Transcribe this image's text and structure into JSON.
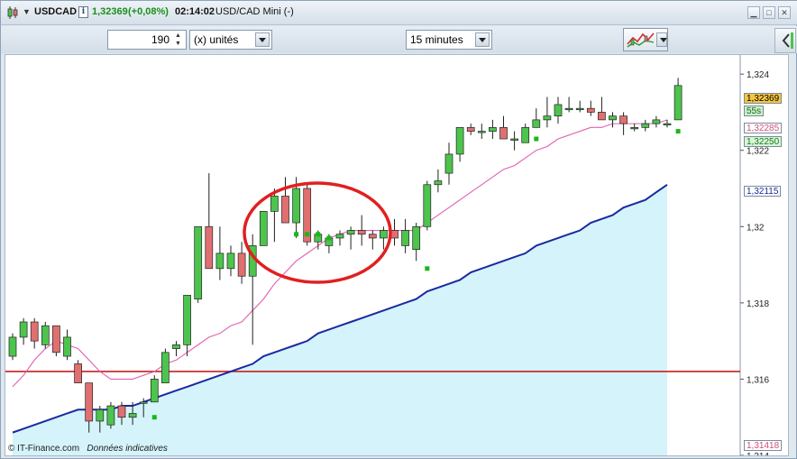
{
  "window": {
    "instrument": "USDCAD",
    "last": "1,32369",
    "change": "(+0,08%)",
    "time": "02:14:02",
    "description": "USD/CAD Mini (-)",
    "up_color": "#1a8f1a"
  },
  "toolbar": {
    "units_value": "190",
    "units_label": "(x) unités",
    "timeframe": "15 minutes"
  },
  "price_tags": [
    {
      "text": "1,32369",
      "bg": "#f5c542",
      "color": "#000000"
    },
    {
      "text": "55s",
      "bg": "#c9f0c9",
      "color": "#226622"
    },
    {
      "text": "1,32285",
      "bg": "#ffffff",
      "color": "#d0507a"
    },
    {
      "text": "1,32250",
      "bg": "#d8f5d8",
      "color": "#1a7a1a"
    },
    {
      "text": "1,32115",
      "bg": "#ffffff",
      "color": "#1a2a9a"
    },
    {
      "text": "1,31418",
      "bg": "#ffffff",
      "color": "#d0507a"
    }
  ],
  "footer": {
    "copyright": "© IT-Finance.com",
    "disclaimer": "Données indicatives"
  },
  "chart_data": {
    "type": "candlestick",
    "ylim": [
      1.314,
      1.3245
    ],
    "yticks": [
      "1,324",
      "1,322",
      "1,32",
      "1,318",
      "1,316",
      "1,314"
    ],
    "ytick_values": [
      1.324,
      1.322,
      1.32,
      1.318,
      1.316,
      1.314
    ],
    "colors": {
      "up": "#4dc44d",
      "down": "#e07070",
      "ma_short": "#e060b0",
      "ma_long": "#1a2aa0",
      "hline": "#c81e1e",
      "sar": "#18b818",
      "annotation": "#e02020",
      "area": "#d4f3fa"
    },
    "candles": [
      [
        1.3166,
        1.3172,
        1.3165,
        1.3171
      ],
      [
        1.3171,
        1.3176,
        1.3169,
        1.3175
      ],
      [
        1.3175,
        1.3176,
        1.3168,
        1.317
      ],
      [
        1.3169,
        1.3175,
        1.3168,
        1.3174
      ],
      [
        1.3174,
        1.3174,
        1.3166,
        1.3167
      ],
      [
        1.3166,
        1.3173,
        1.3165,
        1.3171
      ],
      [
        1.3164,
        1.3165,
        1.3159,
        1.3159
      ],
      [
        1.3159,
        1.3159,
        1.3146,
        1.3149
      ],
      [
        1.3149,
        1.3153,
        1.3146,
        1.3152
      ],
      [
        1.3148,
        1.3154,
        1.3147,
        1.3153
      ],
      [
        1.3153,
        1.3154,
        1.3148,
        1.315
      ],
      [
        1.315,
        1.3154,
        1.3148,
        1.3151
      ],
      [
        1.3154,
        1.3155,
        1.315,
        1.3154
      ],
      [
        1.3154,
        1.3161,
        1.3154,
        1.316
      ],
      [
        1.3159,
        1.3168,
        1.3159,
        1.3167
      ],
      [
        1.3168,
        1.317,
        1.3166,
        1.3169
      ],
      [
        1.3169,
        1.3181,
        1.3166,
        1.3182
      ],
      [
        1.3181,
        1.32,
        1.318,
        1.32
      ],
      [
        1.32,
        1.3214,
        1.3196,
        1.3189
      ],
      [
        1.3189,
        1.32,
        1.3186,
        1.3193
      ],
      [
        1.3189,
        1.3195,
        1.3187,
        1.3193
      ],
      [
        1.3193,
        1.3196,
        1.3185,
        1.3187
      ],
      [
        1.3187,
        1.3198,
        1.3169,
        1.3195
      ],
      [
        1.3195,
        1.3204,
        1.3195,
        1.3204
      ],
      [
        1.3204,
        1.321,
        1.3196,
        1.3208
      ],
      [
        1.3208,
        1.3213,
        1.3206,
        1.3201
      ],
      [
        1.3201,
        1.3213,
        1.3197,
        1.321
      ],
      [
        1.321,
        1.3211,
        1.3195,
        1.3196
      ],
      [
        1.3196,
        1.3199,
        1.3194,
        1.3198
      ],
      [
        1.3195,
        1.3198,
        1.3193,
        1.3197
      ],
      [
        1.3197,
        1.3199,
        1.3195,
        1.3198
      ],
      [
        1.3198,
        1.32,
        1.3194,
        1.3199
      ],
      [
        1.3199,
        1.3203,
        1.3195,
        1.3198
      ],
      [
        1.3198,
        1.3199,
        1.3194,
        1.3197
      ],
      [
        1.3197,
        1.32,
        1.3194,
        1.3199
      ],
      [
        1.3199,
        1.3202,
        1.3195,
        1.3197
      ],
      [
        1.3195,
        1.3202,
        1.3193,
        1.3199
      ],
      [
        1.3194,
        1.3201,
        1.3191,
        1.32
      ],
      [
        1.32,
        1.3212,
        1.3199,
        1.3211
      ],
      [
        1.3211,
        1.3215,
        1.3209,
        1.3212
      ],
      [
        1.3214,
        1.3222,
        1.3211,
        1.3219
      ],
      [
        1.3219,
        1.3226,
        1.3217,
        1.3226
      ],
      [
        1.3226,
        1.3227,
        1.3224,
        1.3225
      ],
      [
        1.3225,
        1.3227,
        1.3223,
        1.3225
      ],
      [
        1.3225,
        1.3228,
        1.3223,
        1.3226
      ],
      [
        1.3226,
        1.3229,
        1.3223,
        1.3223
      ],
      [
        1.3223,
        1.3225,
        1.322,
        1.3223
      ],
      [
        1.3222,
        1.3227,
        1.3222,
        1.3226
      ],
      [
        1.3226,
        1.3231,
        1.3226,
        1.3228
      ],
      [
        1.3228,
        1.3234,
        1.3226,
        1.3229
      ],
      [
        1.3229,
        1.3234,
        1.3227,
        1.3232
      ],
      [
        1.3231,
        1.3234,
        1.323,
        1.3231
      ],
      [
        1.3231,
        1.3233,
        1.323,
        1.3231
      ],
      [
        1.3231,
        1.3233,
        1.3229,
        1.323
      ],
      [
        1.323,
        1.3234,
        1.3228,
        1.3228
      ],
      [
        1.3228,
        1.323,
        1.3226,
        1.3229
      ],
      [
        1.3229,
        1.323,
        1.3224,
        1.3227
      ],
      [
        1.3226,
        1.3227,
        1.3225,
        1.3226
      ],
      [
        1.3226,
        1.3228,
        1.3225,
        1.3227
      ],
      [
        1.3227,
        1.3229,
        1.3226,
        1.3228
      ],
      [
        1.3227,
        1.3228,
        1.3226,
        1.3227
      ],
      [
        1.3228,
        1.3239,
        1.3228,
        1.3237
      ]
    ],
    "ma_short": [
      1.3158,
      1.3161,
      1.3165,
      1.3168,
      1.317,
      1.3169,
      1.3168,
      1.3165,
      1.3162,
      1.316,
      1.316,
      1.316,
      1.3161,
      1.3162,
      1.3164,
      1.3165,
      1.3167,
      1.3169,
      1.3171,
      1.3172,
      1.3174,
      1.3175,
      1.3178,
      1.3181,
      1.3185,
      1.3188,
      1.3191,
      1.3193,
      1.3195,
      1.3197,
      1.3198,
      1.3199,
      1.3199,
      1.3199,
      1.3199,
      1.3199,
      1.3199,
      1.3199,
      1.3201,
      1.3203,
      1.3205,
      1.3207,
      1.3209,
      1.3211,
      1.3213,
      1.3215,
      1.3216,
      1.3218,
      1.322,
      1.3221,
      1.3223,
      1.3224,
      1.3225,
      1.3226,
      1.3226,
      1.3227,
      1.3227,
      1.3227,
      1.3227,
      1.3227,
      1.3228
    ],
    "ma_long": [
      1.3146,
      1.3147,
      1.3148,
      1.3149,
      1.315,
      1.3151,
      1.3152,
      1.3152,
      1.3152,
      1.3152,
      1.3153,
      1.3153,
      1.3154,
      1.3155,
      1.3156,
      1.3157,
      1.3158,
      1.3159,
      1.316,
      1.3161,
      1.3162,
      1.3163,
      1.3164,
      1.3166,
      1.3167,
      1.3168,
      1.3169,
      1.317,
      1.3172,
      1.3173,
      1.3174,
      1.3175,
      1.3176,
      1.3177,
      1.3178,
      1.3179,
      1.318,
      1.3181,
      1.3183,
      1.3184,
      1.3185,
      1.3186,
      1.3188,
      1.3189,
      1.319,
      1.3191,
      1.3192,
      1.3193,
      1.3195,
      1.3196,
      1.3197,
      1.3198,
      1.3199,
      1.3201,
      1.3202,
      1.3203,
      1.3205,
      1.3206,
      1.3207,
      1.3209,
      1.3211
    ],
    "hline": 1.3162,
    "sar": [
      [
        13,
        1.315
      ],
      [
        26,
        1.3198
      ],
      [
        27,
        1.3198
      ],
      [
        28,
        1.3198
      ],
      [
        29,
        1.3197
      ],
      [
        38,
        1.3189
      ],
      [
        48,
        1.3223
      ],
      [
        61,
        1.3225
      ]
    ]
  }
}
